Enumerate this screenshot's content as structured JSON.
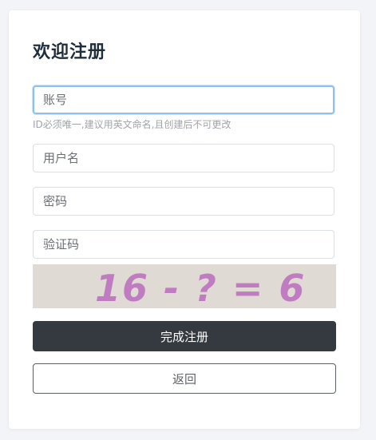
{
  "form": {
    "title": "欢迎注册",
    "account_placeholder": "账号",
    "account_hint": "ID必须唯一,建议用英文命名,且创建后不可更改",
    "username_placeholder": "用户名",
    "password_placeholder": "密码",
    "captcha_placeholder": "验证码",
    "captcha_image_text": "16 - ? = 6",
    "submit_label": "完成注册",
    "back_label": "返回"
  },
  "colors": {
    "primary_button": "#353940",
    "focus_border": "#8fc0ef",
    "captcha_text": "#c07cc0",
    "captcha_background": "#dfdad4"
  }
}
